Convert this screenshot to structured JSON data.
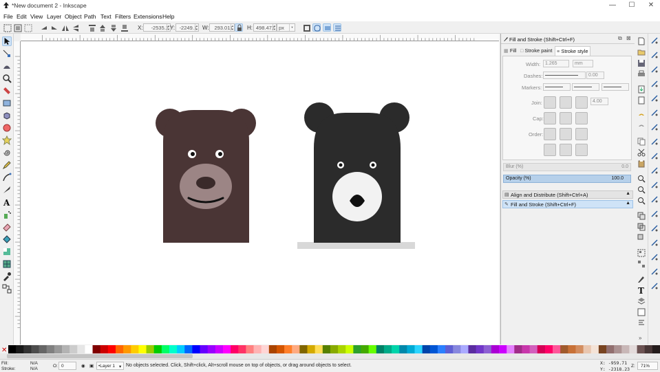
{
  "window": {
    "title": "*New document 2 - Inkscape",
    "minimize": "—",
    "maximize": "☐",
    "close": "✕"
  },
  "menu": [
    "File",
    "Edit",
    "View",
    "Layer",
    "Object",
    "Path",
    "Text",
    "Filters",
    "Extensions",
    "Help"
  ],
  "toolbar": {
    "x_label": "X:",
    "x_value": "-2535.2",
    "y_label": "Y:",
    "y_value": "-2249.1",
    "w_label": "W:",
    "w_value": "293.011",
    "h_label": "H:",
    "h_value": "498.472",
    "unit": "px"
  },
  "panel": {
    "header_title": "Fill and Stroke (Shift+Ctrl+F)",
    "tab_fill": "Fill",
    "tab_stroke_paint": "Stroke paint",
    "tab_stroke_style": "Stroke style",
    "width_label": "Width:",
    "width_value": "1.265",
    "width_unit": "mm",
    "dashes_label": "Dashes:",
    "dashes_value": "0.00",
    "markers_label": "Markers:",
    "join_label": "Join:",
    "miter_value": "4.00",
    "cap_label": "Cap:",
    "order_label": "Order:",
    "blur_label": "Blur (%)",
    "blur_value": "0.0",
    "opacity_label": "Opacity (%)",
    "opacity_value": "100.0",
    "dock_align": "Align and Distribute (Shift+Ctrl+A)",
    "dock_fill": "Fill and Stroke (Shift+Ctrl+F)"
  },
  "status": {
    "fill_label": "Fill:",
    "fill_value": "N/A",
    "stroke_label": "Stroke:",
    "stroke_value": "N/A",
    "opacity_label": "O:",
    "opacity_value": "0",
    "layer": "•Layer 1",
    "message": "No objects selected. Click, Shift+click, Alt+scroll mouse on top of objects, or drag around objects to select.",
    "x_coord": "X: -959.71",
    "y_coord": "Y: -2318.23",
    "zoom_label": "Z:",
    "zoom_value": "71%"
  },
  "colors": {
    "bear1_body": "#4a3535",
    "bear1_ear_inner": "#111111",
    "bear1_muzzle": "#9c8585",
    "bear2_body": "#2b2b2b",
    "bear2_muzzle": "#f2f2f2",
    "accent": "#cfe3f7"
  }
}
